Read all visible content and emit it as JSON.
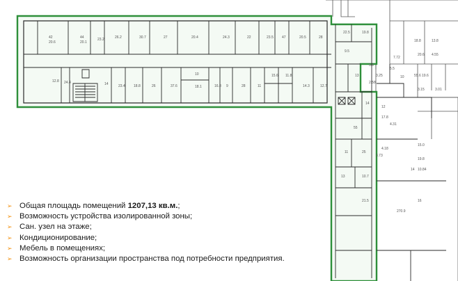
{
  "plan": {
    "highlight_color": "#2e8f3a",
    "wall_color": "#2a2a2a",
    "text_color": "#555555",
    "room_labels": [
      "42",
      "20.6",
      "44",
      "20.1",
      "23.2",
      "26.2",
      "30.7",
      "27",
      "20.4",
      "24.3",
      "22",
      "23.5",
      "47",
      "20.5",
      "28",
      "12.8",
      "24.4",
      "14",
      "23.4",
      "18.8",
      "26",
      "37.6",
      "10",
      "18.1",
      "16.8",
      "9",
      "28",
      "11",
      "15.6",
      "11.8",
      "14.3",
      "12.7",
      "22.5",
      "19.8",
      "9.5",
      "13",
      "14",
      "55",
      "11",
      "25",
      "13",
      "10.7",
      "12",
      "17.8",
      "15.0",
      "19.8",
      "14",
      "10",
      "5.5",
      "55.6",
      "19.6",
      "16",
      "270.9",
      "21.5",
      "10.84",
      "4.31",
      "3.25",
      "2.58",
      "18.8",
      "13.8",
      "20.6",
      "4.55",
      "7.72",
      "3.15",
      "3.01",
      "3.73",
      "4.18",
      "5.6"
    ]
  },
  "features": [
    {
      "text": "Общая площадь помещений ",
      "bold": "1207,13 кв.м.",
      "tail": ";"
    },
    {
      "text": "Возможность устройства изолированной зоны;",
      "bold": "",
      "tail": ""
    },
    {
      "text": "Сан. узел на этаже;",
      "bold": "",
      "tail": ""
    },
    {
      "text": "Кондиционирование;",
      "bold": "",
      "tail": ""
    },
    {
      "text": "Мебель в помещениях;",
      "bold": "",
      "tail": ""
    },
    {
      "text": "Возможность организации пространства под потребности предприятия.",
      "bold": "",
      "tail": ""
    }
  ]
}
